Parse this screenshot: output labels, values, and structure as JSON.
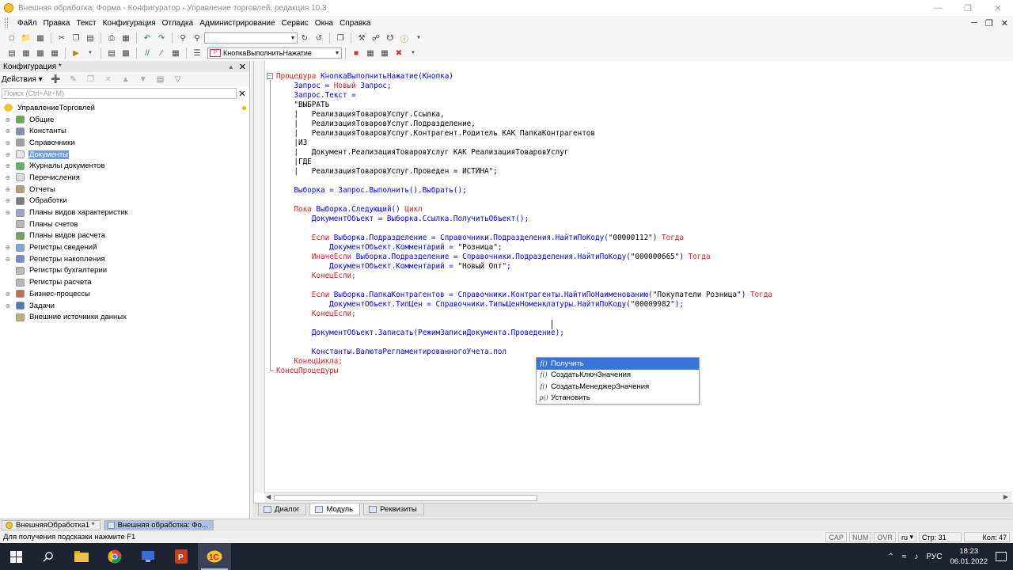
{
  "window": {
    "title": "Внешняя обработка: Форма - Конфигуратор - Управление торговлей, редакция 10.3"
  },
  "menu": {
    "items": [
      "Файл",
      "Правка",
      "Текст",
      "Конфигурация",
      "Отладка",
      "Администрирование",
      "Сервис",
      "Окна",
      "Справка"
    ]
  },
  "toolbar2": {
    "procedure_combo": "КнопкаВыполнитьНажатие"
  },
  "left_panel": {
    "title": "Конфигурация *",
    "actions_label": "Действия",
    "search_placeholder": "Поиск (Ctrl+Alt+M)",
    "root": "УправлениеТорговлей",
    "items": [
      {
        "label": "Общие",
        "icon_color": "#6aa84f",
        "expandable": true
      },
      {
        "label": "Константы",
        "icon_color": "#7d8fb3",
        "expandable": true
      },
      {
        "label": "Справочники",
        "icon_color": "#a0a0a0",
        "expandable": true
      },
      {
        "label": "Документы",
        "icon_color": "#e6e6e6",
        "expandable": true,
        "selected": true
      },
      {
        "label": "Журналы документов",
        "icon_color": "#5cb85c",
        "expandable": true
      },
      {
        "label": "Перечисления",
        "icon_color": "#dcdcdc",
        "expandable": true
      },
      {
        "label": "Отчеты",
        "icon_color": "#b0a080",
        "expandable": true
      },
      {
        "label": "Обработки",
        "icon_color": "#7a7a7a",
        "expandable": true
      },
      {
        "label": "Планы видов характеристик",
        "icon_color": "#9aa6bd",
        "expandable": true
      },
      {
        "label": "Планы счетов",
        "icon_color": "#b8b8b8",
        "expandable": false
      },
      {
        "label": "Планы видов расчета",
        "icon_color": "#6aa84f",
        "expandable": false
      },
      {
        "label": "Регистры сведений",
        "icon_color": "#7fa6d9",
        "expandable": true
      },
      {
        "label": "Регистры накопления",
        "icon_color": "#6e8fc7",
        "expandable": true
      },
      {
        "label": "Регистры бухгалтерии",
        "icon_color": "#b8b8b8",
        "expandable": false
      },
      {
        "label": "Регистры расчета",
        "icon_color": "#b8b8b8",
        "expandable": false
      },
      {
        "label": "Бизнес-процессы",
        "icon_color": "#c07050",
        "expandable": true
      },
      {
        "label": "Задачи",
        "icon_color": "#4a7ab8",
        "expandable": true
      },
      {
        "label": "Внешние источники данных",
        "icon_color": "#c0b070",
        "expandable": false
      }
    ]
  },
  "code": {
    "lines": [
      [
        {
          "t": "Процедура ",
          "c": "kw"
        },
        {
          "t": "КнопкаВыполнитьНажатие(Кнопка)",
          "c": "ident"
        }
      ],
      [
        {
          "t": "    Запрос = ",
          "c": "ident"
        },
        {
          "t": "Новый ",
          "c": "kw"
        },
        {
          "t": "Запрос;",
          "c": "ident"
        }
      ],
      [
        {
          "t": "    Запрос.Текст =",
          "c": "ident"
        }
      ],
      [
        {
          "t": "    \"ВЫБРАТЬ",
          "c": "str"
        }
      ],
      [
        {
          "t": "    |   РеализацияТоваровУслуг.Ссылка,",
          "c": "str"
        }
      ],
      [
        {
          "t": "    |   РеализацияТоваровУслуг.Подразделение,",
          "c": "str"
        }
      ],
      [
        {
          "t": "    |   РеализацияТоваровУслуг.Контрагент.Родитель КАК ПапкаКонтрагентов",
          "c": "str"
        }
      ],
      [
        {
          "t": "    |ИЗ",
          "c": "str"
        }
      ],
      [
        {
          "t": "    |   Документ.РеализацияТоваровУслуг КАК РеализацияТоваровУслуг",
          "c": "str"
        }
      ],
      [
        {
          "t": "    |ГДЕ",
          "c": "str"
        }
      ],
      [
        {
          "t": "    |   РеализацияТоваровУслуг.Проведен = ИСТИНА\";",
          "c": "str"
        }
      ],
      [
        {
          "t": "",
          "c": "ident"
        }
      ],
      [
        {
          "t": "    Выборка = Запрос.Выполнить().Выбрать();",
          "c": "ident"
        }
      ],
      [
        {
          "t": "",
          "c": "ident"
        }
      ],
      [
        {
          "t": "    ",
          "c": "ident"
        },
        {
          "t": "Пока ",
          "c": "kw"
        },
        {
          "t": "Выборка.Следующий() ",
          "c": "ident"
        },
        {
          "t": "Цикл",
          "c": "kw"
        }
      ],
      [
        {
          "t": "        ДокументОбъект = Выборка.Ссылка.ПолучитьОбъект();",
          "c": "ident"
        }
      ],
      [
        {
          "t": "",
          "c": "ident"
        }
      ],
      [
        {
          "t": "        ",
          "c": "ident"
        },
        {
          "t": "Если ",
          "c": "kw"
        },
        {
          "t": "Выборка.Подразделение = Справочники.Подразделения.НайтиПоКоду(",
          "c": "ident"
        },
        {
          "t": "\"00000112\"",
          "c": "str"
        },
        {
          "t": ") ",
          "c": "ident"
        },
        {
          "t": "Тогда",
          "c": "kw"
        }
      ],
      [
        {
          "t": "            ДокументОбъект.Комментарий = ",
          "c": "ident"
        },
        {
          "t": "\"Розница\"",
          "c": "str"
        },
        {
          "t": ";",
          "c": "ident"
        }
      ],
      [
        {
          "t": "        ",
          "c": "ident"
        },
        {
          "t": "ИначеЕсли ",
          "c": "kw"
        },
        {
          "t": "Выборка.Подразделение = Справочники.Подразделения.НайтиПоКоду(",
          "c": "ident"
        },
        {
          "t": "\"000000665\"",
          "c": "str"
        },
        {
          "t": ") ",
          "c": "ident"
        },
        {
          "t": "Тогда",
          "c": "kw"
        }
      ],
      [
        {
          "t": "            ДокументОбъект.Комментарий = ",
          "c": "ident"
        },
        {
          "t": "\"Новый Опт\"",
          "c": "str"
        },
        {
          "t": ";",
          "c": "ident"
        }
      ],
      [
        {
          "t": "        ",
          "c": "ident"
        },
        {
          "t": "КонецЕсли;",
          "c": "kw"
        }
      ],
      [
        {
          "t": "",
          "c": "ident"
        }
      ],
      [
        {
          "t": "        ",
          "c": "ident"
        },
        {
          "t": "Если ",
          "c": "kw"
        },
        {
          "t": "Выборка.ПапкаКонтрагентов = Справочники.Контрагенты.НайтиПоНаименованию(",
          "c": "ident"
        },
        {
          "t": "\"Покупатели Розница\"",
          "c": "str"
        },
        {
          "t": ") ",
          "c": "ident"
        },
        {
          "t": "Тогда",
          "c": "kw"
        }
      ],
      [
        {
          "t": "            ДокументОбъект.ТипЦен = Справочники.ТипыЦенНоменклатуры.НайтиПоКоду(",
          "c": "ident"
        },
        {
          "t": "\"00009982\"",
          "c": "str"
        },
        {
          "t": ");",
          "c": "ident"
        }
      ],
      [
        {
          "t": "        ",
          "c": "ident"
        },
        {
          "t": "КонецЕсли;",
          "c": "kw"
        }
      ],
      [
        {
          "t": "",
          "c": "ident"
        }
      ],
      [
        {
          "t": "        ДокументОбъект.Записать(РежимЗаписиДокумента.Проведение);",
          "c": "ident"
        }
      ],
      [
        {
          "t": "",
          "c": "ident"
        }
      ],
      [
        {
          "t": "        Константы.ВалютаРегламентированногоУчета.пол",
          "c": "ident"
        }
      ],
      [
        {
          "t": "    ",
          "c": "ident"
        },
        {
          "t": "КонецЦикла;",
          "c": "kw"
        }
      ],
      [
        {
          "t": "КонецПроцедуры",
          "c": "kw"
        }
      ]
    ]
  },
  "autocomplete": {
    "items": [
      {
        "icon": "f()",
        "label": "Получить",
        "selected": true
      },
      {
        "icon": "f()",
        "label": "СоздатьКлючЗначения",
        "selected": false
      },
      {
        "icon": "f()",
        "label": "СоздатьМенеджерЗначения",
        "selected": false
      },
      {
        "icon": "p()",
        "label": "Установить",
        "selected": false
      }
    ]
  },
  "editor_tabs": {
    "dialog": "Диалог",
    "module": "Модуль",
    "requisites": "Реквизиты"
  },
  "windows_bar": {
    "tab1": "ВнешняяОбработка1 *",
    "tab2": "Внешняя обработка: Фо..."
  },
  "status": {
    "hint": "Для получения подсказки нажмите F1",
    "cap": "CAP",
    "num": "NUM",
    "ovr": "OVR",
    "lang": "ru",
    "row": "Стр: 31",
    "col": "Кол: 47"
  },
  "taskbar": {
    "lang": "РУС",
    "time": "18:23",
    "date": "06.01.2022"
  },
  "colors": {
    "keyword": "#e02020",
    "identifier": "#0000ff",
    "selection": "#3875d7",
    "taskbar": "#1c2230"
  }
}
